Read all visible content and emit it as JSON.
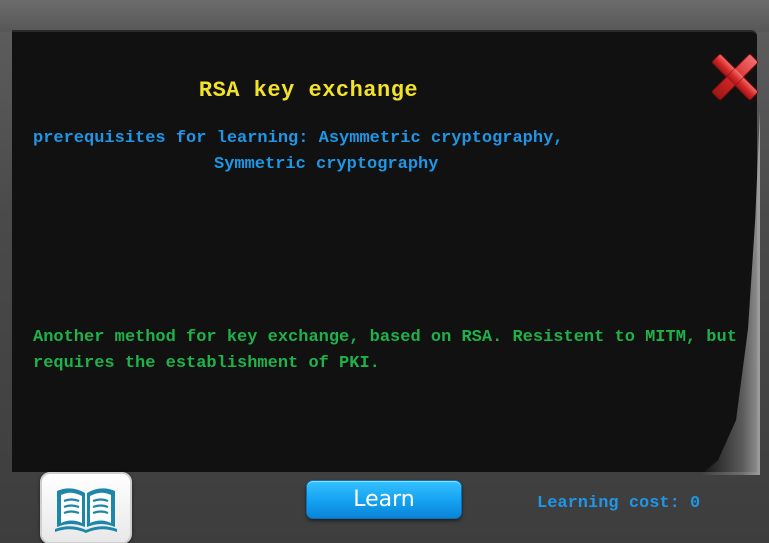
{
  "card": {
    "title": "RSA key exchange",
    "prerequisites_line1": "prerequisites for learning: Asymmetric cryptography,",
    "prerequisites_line2": "Symmetric cryptography",
    "description": "Another method for key exchange, based on RSA. Resistent to MITM, but requires the establishment of PKI."
  },
  "footer": {
    "learn_label": "Learn",
    "cost_label": "Learning cost:",
    "cost_value": "0"
  },
  "icons": {
    "close": "close-icon",
    "book": "book-icon"
  },
  "colors": {
    "title": "#f2e22a",
    "prerequisites": "#1f96e6",
    "description": "#1fb14a",
    "learn_button": "#14a0f0",
    "board": "#111111"
  }
}
